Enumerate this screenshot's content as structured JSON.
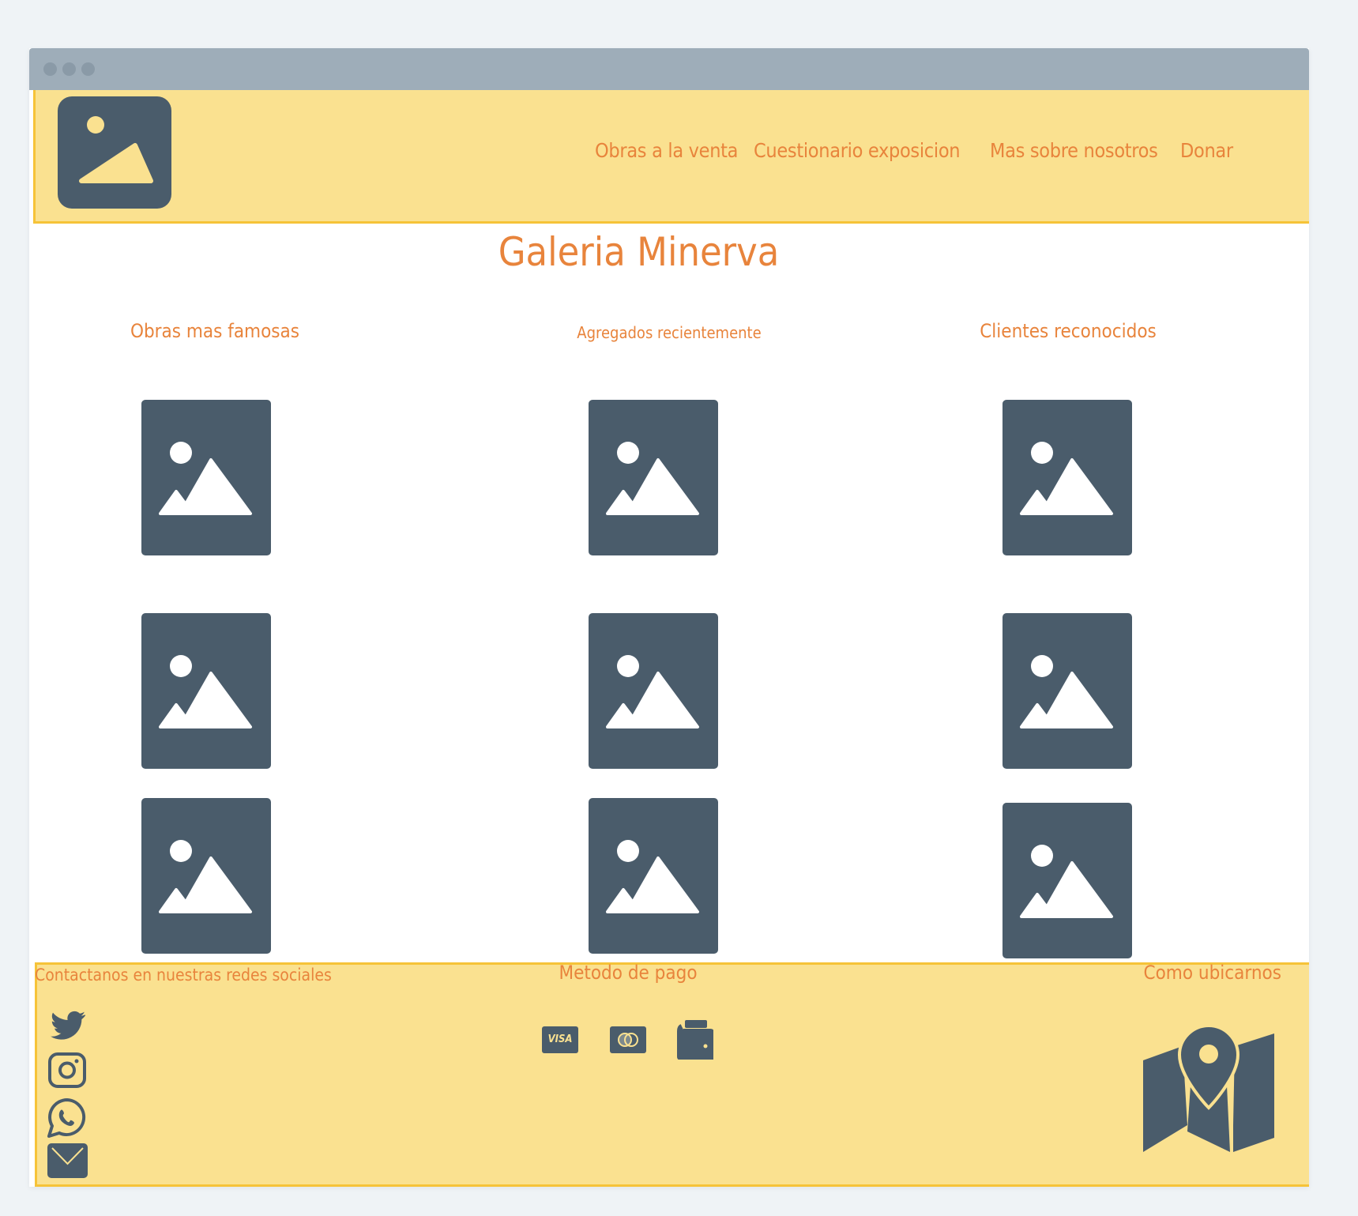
{
  "nav": {
    "items": [
      {
        "label": "Obras a la venta"
      },
      {
        "label": "Cuestionario exposicion"
      },
      {
        "label": "Mas sobre nosotros"
      },
      {
        "label": "Donar"
      }
    ]
  },
  "page": {
    "title": "Galeria Minerva"
  },
  "sections": [
    {
      "heading": "Obras mas famosas"
    },
    {
      "heading": "Agregados recientemente"
    },
    {
      "heading": "Clientes reconocidos"
    }
  ],
  "footer": {
    "contact_heading": "Contactanos en nuestras redes sociales",
    "payment_heading": "Metodo de pago",
    "location_heading": "Como ubicarnos",
    "visa_label": "VISA",
    "social_icons": [
      "twitter-icon",
      "instagram-icon",
      "whatsapp-icon",
      "mail-icon"
    ],
    "payment_icons": [
      "visa-icon",
      "mastercard-icon",
      "wallet-icon"
    ]
  },
  "colors": {
    "accent": "#e8843c",
    "header_bg": "#fae190",
    "border": "#f6c338",
    "icon": "#4a5c6b",
    "titlebar": "#9eadb9"
  }
}
